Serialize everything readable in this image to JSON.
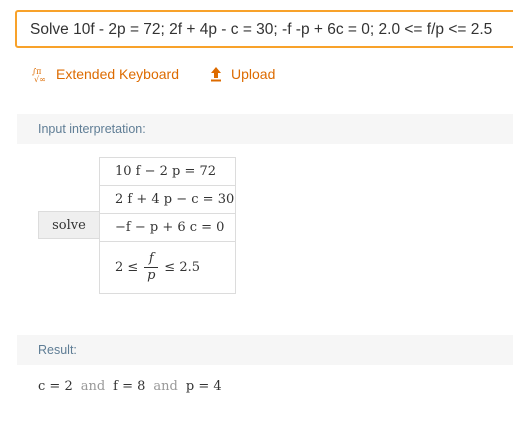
{
  "query": {
    "text": "Solve 10f - 2p = 72; 2f + 4p - c = 30; -f -p + 6c = 0; 2.0 <= f/p <= 2.5"
  },
  "toolbar": {
    "extended_keyboard_label": "Extended Keyboard",
    "extended_keyboard_icon": "extended-keyboard-icon",
    "upload_label": "Upload",
    "upload_icon": "upload-arrow-icon"
  },
  "interpretation": {
    "title": "Input interpretation:",
    "command": "solve",
    "equations": [
      "10 f − 2 p = 72",
      "2 f + 4 p − c = 30",
      "−f − p + 6 c = 0"
    ],
    "inequality": {
      "left": "2 ≤",
      "numerator": "f",
      "denominator": "p",
      "right": "≤ 2.5"
    }
  },
  "result": {
    "title": "Result:",
    "terms": [
      "c = 2",
      "f = 8",
      "p = 4"
    ],
    "connector": "and"
  },
  "colors": {
    "accent": "#f8a22a",
    "link": "#dd6b00",
    "pod_title": "#5f7d95",
    "pod_background": "#f6f6f6"
  }
}
